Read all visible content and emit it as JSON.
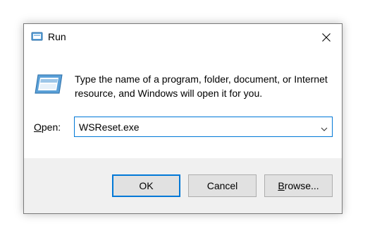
{
  "window": {
    "title": "Run",
    "icon": "run-icon",
    "close_icon": "close-icon"
  },
  "content": {
    "description": "Type the name of a program, folder, document, or Internet resource, and Windows will open it for you.",
    "open_label_prefix": "",
    "open_label_accel": "O",
    "open_label_rest": "pen:",
    "open_value": "WSReset.exe"
  },
  "buttons": {
    "ok": "OK",
    "cancel": "Cancel",
    "browse_accel": "B",
    "browse_rest": "rowse..."
  },
  "colors": {
    "accent": "#0078d7",
    "footer_bg": "#f0f0f0",
    "button_bg": "#e1e1e1"
  }
}
